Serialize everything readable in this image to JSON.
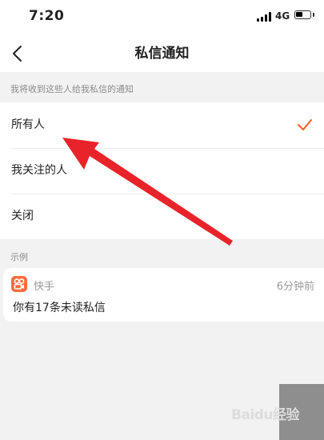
{
  "status_bar": {
    "time": "7:20",
    "network": "4G"
  },
  "nav": {
    "title": "私信通知"
  },
  "notify_section": {
    "header": "我将收到这些人给我私信的通知",
    "options": [
      {
        "label": "所有人",
        "selected": true
      },
      {
        "label": "我关注的人",
        "selected": false
      },
      {
        "label": "关闭",
        "selected": false
      }
    ]
  },
  "example_section": {
    "header": "示例",
    "card": {
      "app_name": "快手",
      "time": "6分钟前",
      "message": "你有17条未读私信"
    }
  },
  "watermark": {
    "text": "Baidu经验"
  },
  "colors": {
    "accent": "#ff5a1f",
    "arrow": "#e8242a",
    "app_icon": "#ff6a3d"
  }
}
